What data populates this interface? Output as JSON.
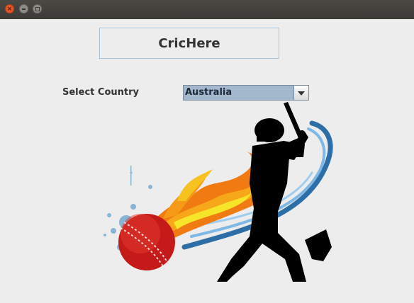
{
  "window": {
    "close_glyph": "×"
  },
  "header": {
    "title": "CricHere"
  },
  "form": {
    "country_label": "Select Country",
    "country_selected": "Australia"
  },
  "illustration": {
    "subject": "cricket-batsman-with-fireball",
    "colors": {
      "silhouette": "#000000",
      "ball": "#c41a1a",
      "flame_outer": "#f07b12",
      "flame_inner": "#f7e52a",
      "swoosh": "#3f8ec9"
    }
  }
}
